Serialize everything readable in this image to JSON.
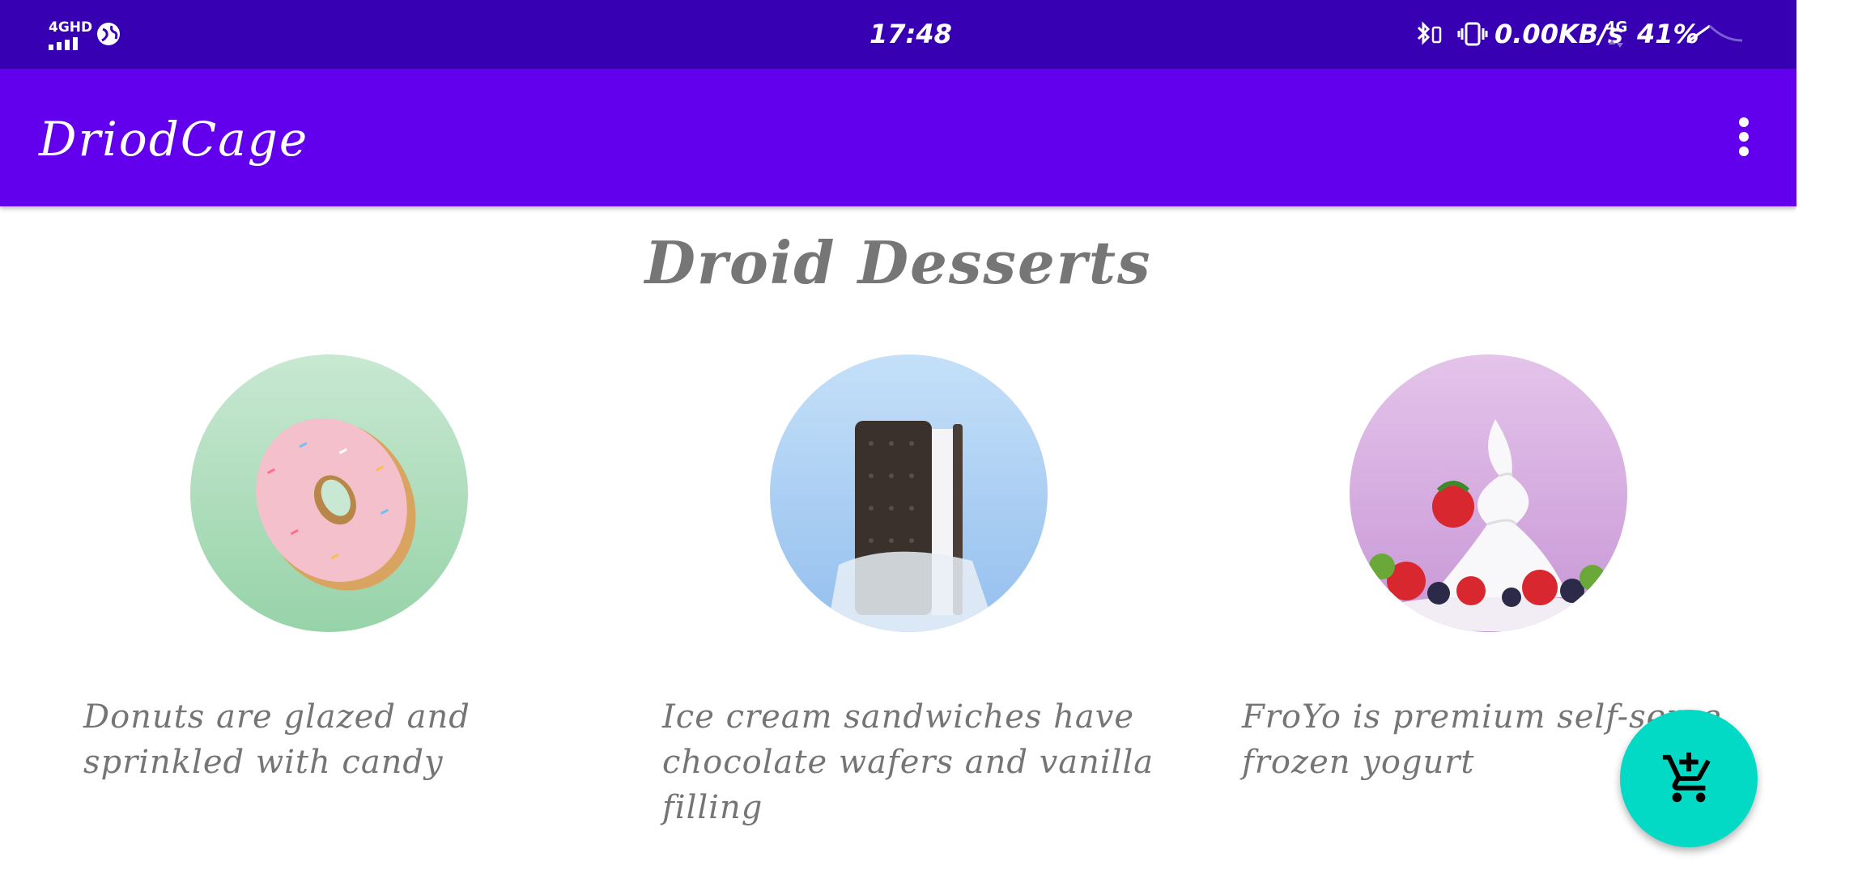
{
  "status_bar": {
    "network_type": "4GHD",
    "time": "17:48",
    "speed": "0.00KB/s",
    "mobile_data": "4G",
    "battery": "41%",
    "icons": [
      "signal-icon",
      "globe-icon",
      "bluetooth-icon",
      "vibrate-icon",
      "wifi-icon"
    ]
  },
  "app_bar": {
    "title": "DriodCage",
    "menu_icon": "more-vert-icon"
  },
  "page": {
    "title": "Droid Desserts"
  },
  "desserts": [
    {
      "image": "donut-image",
      "description": "Donuts are glazed and sprinkled with candy"
    },
    {
      "image": "ice-cream-sandwich-image",
      "description": "Ice cream sandwiches have chocolate wafers and vanilla filling"
    },
    {
      "image": "froyo-image",
      "description": "FroYo is premium self-serve frozen yogurt"
    }
  ],
  "fab": {
    "icon": "add-shopping-cart-icon"
  },
  "colors": {
    "status_bar": "#3700b3",
    "app_bar": "#6200ee",
    "fab": "#03dac5",
    "text_gray": "#757575"
  }
}
